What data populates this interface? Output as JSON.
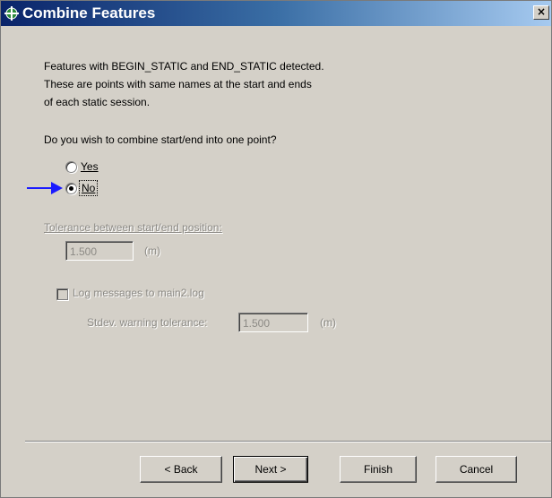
{
  "window": {
    "title": "Combine Features",
    "close_label": "×"
  },
  "description": {
    "line1": "Features with BEGIN_STATIC and END_STATIC detected.",
    "line2": "These are points with same names at the start and ends",
    "line3": "of each static session."
  },
  "combine": {
    "question": "Do you wish to combine start/end into one point?",
    "options": [
      {
        "label": "Yes",
        "selected": false
      },
      {
        "label": "No",
        "selected": true
      }
    ]
  },
  "tolerance": {
    "label": "Tolerance between start/end position:",
    "value": "1.500",
    "unit": "(m)"
  },
  "logging": {
    "checkbox_label": "Log messages to main2.log",
    "checked": false,
    "stdev_label": "Stdev. warning tolerance:",
    "stdev_value": "1.500",
    "stdev_unit": "(m)"
  },
  "buttons": {
    "back": "< Back",
    "next": "Next >",
    "finish": "Finish",
    "cancel": "Cancel"
  },
  "colors": {
    "title_gradient_start": "#0a246a",
    "title_gradient_end": "#a6caf0",
    "dialog_background": "#d4d0c8",
    "arrow": "#1a1aff",
    "disabled_text": "#8c8a85"
  }
}
